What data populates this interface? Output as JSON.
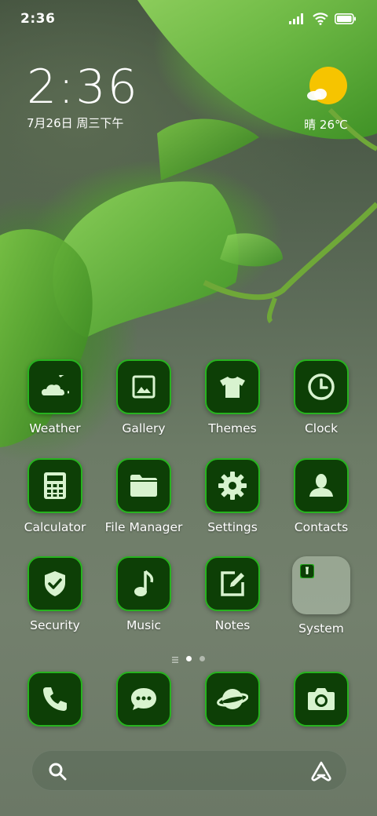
{
  "status_bar": {
    "time": "2:36",
    "icons": [
      "signal-icon",
      "wifi-icon",
      "battery-icon"
    ]
  },
  "clock_widget": {
    "time": "2:36",
    "date": "7月26日 周三下午"
  },
  "weather_widget": {
    "condition_icon": "sunny-partly-cloudy-icon",
    "text": "晴 26℃"
  },
  "apps": [
    {
      "label": "Weather",
      "icon": "weather-icon"
    },
    {
      "label": "Gallery",
      "icon": "gallery-icon"
    },
    {
      "label": "Themes",
      "icon": "themes-icon"
    },
    {
      "label": "Clock",
      "icon": "clock-icon"
    },
    {
      "label": "Calculator",
      "icon": "calculator-icon"
    },
    {
      "label": "File Manager",
      "icon": "folder-icon"
    },
    {
      "label": "Settings",
      "icon": "gear-icon"
    },
    {
      "label": "Contacts",
      "icon": "contacts-icon"
    },
    {
      "label": "Security",
      "icon": "shield-icon"
    },
    {
      "label": "Music",
      "icon": "music-note-icon"
    },
    {
      "label": "Notes",
      "icon": "notes-icon"
    },
    {
      "label": "System",
      "icon": "folder-group-icon"
    }
  ],
  "page_indicator": {
    "pages": 2,
    "current": 1
  },
  "dock": [
    {
      "icon": "phone-icon"
    },
    {
      "icon": "messages-icon"
    },
    {
      "icon": "browser-planet-icon"
    },
    {
      "icon": "camera-icon"
    }
  ],
  "search_bar": {
    "icon": "search-icon",
    "assistant_icon": "assistant-icon"
  },
  "colors": {
    "tile_bg": "#0d3f06",
    "tile_border": "#27b31f",
    "icon_fg": "#d8f3cf",
    "sun": "#f6c400"
  }
}
